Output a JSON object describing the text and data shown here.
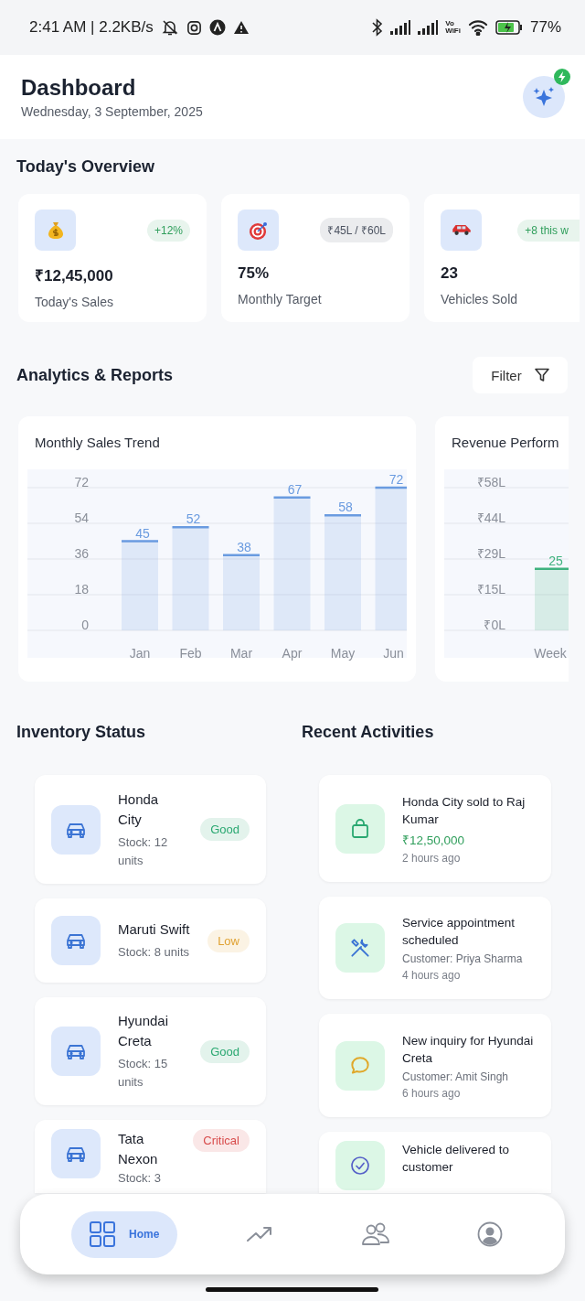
{
  "status_bar": {
    "time": "2:41 AM | 2.2KB/s",
    "vowifi": [
      "Vo",
      "WiFi"
    ],
    "battery": "77%"
  },
  "header": {
    "title": "Dashboard",
    "date": "Wednesday, 3 September, 2025"
  },
  "overview": {
    "title": "Today's Overview",
    "cards": [
      {
        "kind": "money",
        "badge": "+12%",
        "color": "#2f9e5b",
        "value": "₹12,45,000",
        "label": "Today's Sales"
      },
      {
        "kind": "target",
        "badge": "₹45L / ₹60L",
        "color": "#4b5260",
        "value": "75%",
        "label": "Monthly Target"
      },
      {
        "kind": "car",
        "badge": "+8 this w",
        "color": "#2f9e5b",
        "value": "23",
        "label": "Vehicles Sold"
      }
    ]
  },
  "analytics": {
    "title": "Analytics & Reports",
    "filter": "Filter",
    "charts": [
      {
        "title": "Monthly Sales Trend",
        "chart_data": {
          "type": "bar",
          "categories": [
            "Jan",
            "Feb",
            "Mar",
            "Apr",
            "May",
            "Jun"
          ],
          "series": [
            {
              "color": "#6a9be0",
              "values": [
                45,
                52,
                38,
                67,
                58,
                72
              ]
            }
          ],
          "ylim": [
            0,
            72
          ],
          "yticks": [
            0,
            18,
            36,
            54,
            72
          ],
          "grid": true,
          "data_labels": true
        }
      },
      {
        "title": "Revenue Perform",
        "chart_data": {
          "type": "bar",
          "categories": [
            "Week"
          ],
          "series": [
            {
              "color": "#3fb27f",
              "values": [
                25
              ]
            }
          ],
          "ylim": [
            0,
            58
          ],
          "yticks": [
            {
              "value": 0,
              "label": "₹0L"
            },
            {
              "value": 14.5,
              "label": "₹15L"
            },
            {
              "value": 29,
              "label": "₹29L"
            },
            {
              "value": 43.5,
              "label": "₹44L"
            },
            {
              "value": 58,
              "label": "₹58L"
            }
          ],
          "grid": true,
          "data_labels": true
        }
      }
    ]
  },
  "inventory": {
    "title": "Inventory Status",
    "items": [
      {
        "name": "Honda City",
        "stock": "Stock: 12 units",
        "status": "Good",
        "color": "#2aa871"
      },
      {
        "name": "Maruti Swift",
        "stock": "Stock: 8 units",
        "status": "Low",
        "color": "#e0a232"
      },
      {
        "name": "Hyundai Creta",
        "stock": "Stock: 15 units",
        "status": "Good",
        "color": "#2aa871"
      },
      {
        "name": "Tata Nexon",
        "stock": "Stock: 3",
        "status": "Critical",
        "color": "#d84b4b"
      }
    ]
  },
  "activities": {
    "title": "Recent Activities",
    "items": [
      {
        "kind": "sale",
        "title": "Honda City sold to Raj Kumar",
        "amount": "₹12,50,000",
        "time": "2 hours ago"
      },
      {
        "kind": "service",
        "title": "Service appointment scheduled",
        "customer": "Customer: Priya Sharma",
        "time": "4 hours ago"
      },
      {
        "kind": "inquiry",
        "title": "New inquiry for Hyundai Creta",
        "customer": "Customer: Amit Singh",
        "time": "6 hours ago"
      },
      {
        "kind": "delivery",
        "title": "Vehicle delivered to customer"
      }
    ]
  },
  "nav": [
    {
      "kind": "home",
      "label": "Home",
      "selected": true
    },
    {
      "kind": "trend",
      "selected": false
    },
    {
      "kind": "people",
      "selected": false
    },
    {
      "kind": "profile",
      "selected": false
    }
  ]
}
